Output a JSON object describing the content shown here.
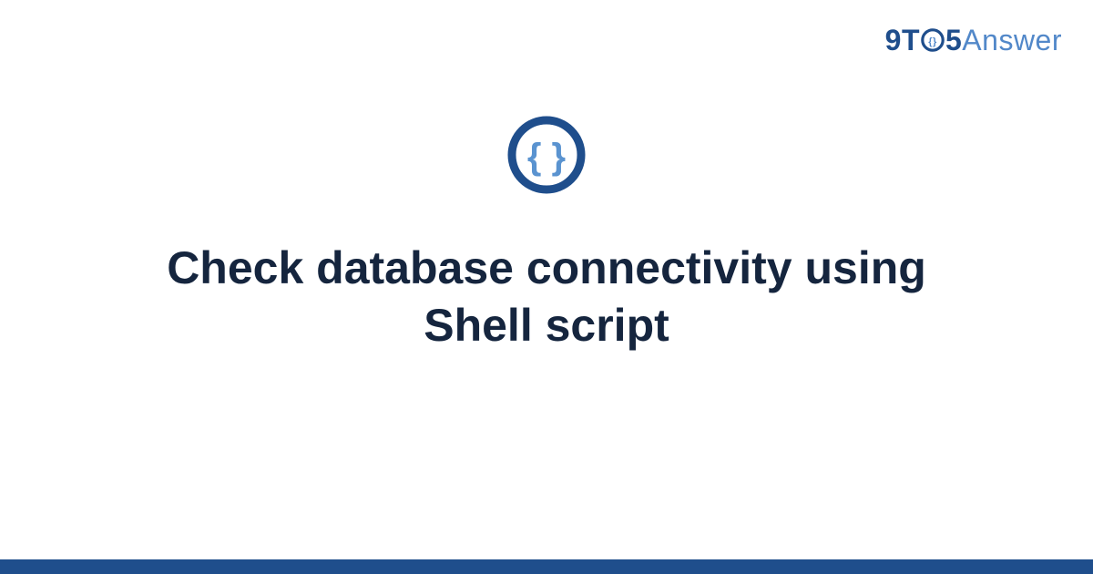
{
  "brand": {
    "part1": "9",
    "part2": "T",
    "part3": "5",
    "part4": "Answer"
  },
  "main": {
    "title": "Check database connectivity using Shell script"
  },
  "icons": {
    "logo_o": "braces-in-circle-small-icon",
    "main_badge": "braces-in-circle-icon"
  },
  "colors": {
    "dark_blue": "#1f4e8c",
    "light_blue": "#5288c9",
    "heading": "#15253e"
  }
}
